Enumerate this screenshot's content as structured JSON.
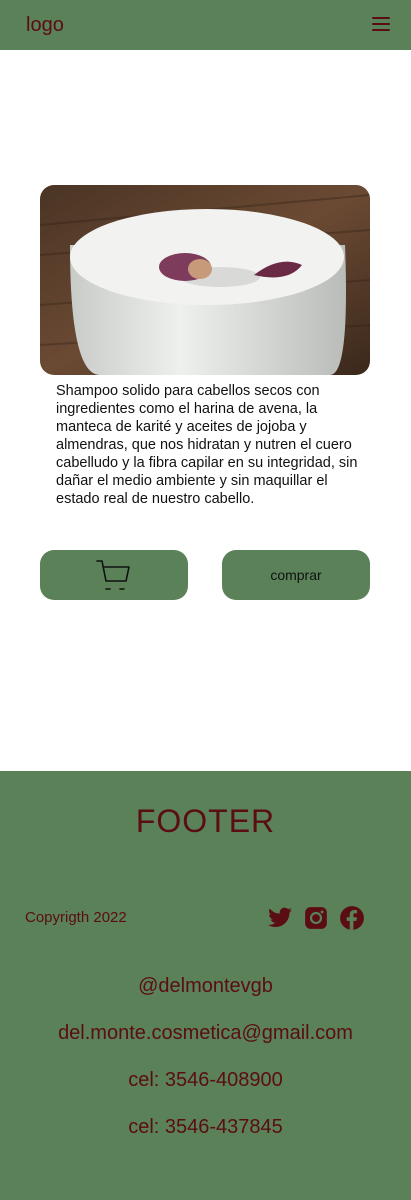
{
  "header": {
    "logo": "logo",
    "menu_icon": "hamburger-menu-icon"
  },
  "product": {
    "description": "Shampoo solido para cabellos secos con ingredientes como el harina de avena, la manteca de karité y aceites de jojoba y almendras, que nos hidratan y nutren el cuero cabelludo y la fibra capilar en su integridad, sin dañar el medio ambiente y sin maquillar el estado real de nuestro cabello.",
    "cart_icon": "shopping-cart-icon",
    "buy_label": "comprar"
  },
  "footer": {
    "title": "FOOTER",
    "copyright": "Copyrigth 2022",
    "social": [
      "twitter-icon",
      "instagram-icon",
      "facebook-icon"
    ],
    "handle": "@delmontevgb",
    "email": "del.monte.cosmetica@gmail.com",
    "phone1": "cel: 3546-408900",
    "phone2": "cel: 3546-437845"
  },
  "colors": {
    "green": "#5b8158",
    "maroon": "#5a0d12"
  }
}
